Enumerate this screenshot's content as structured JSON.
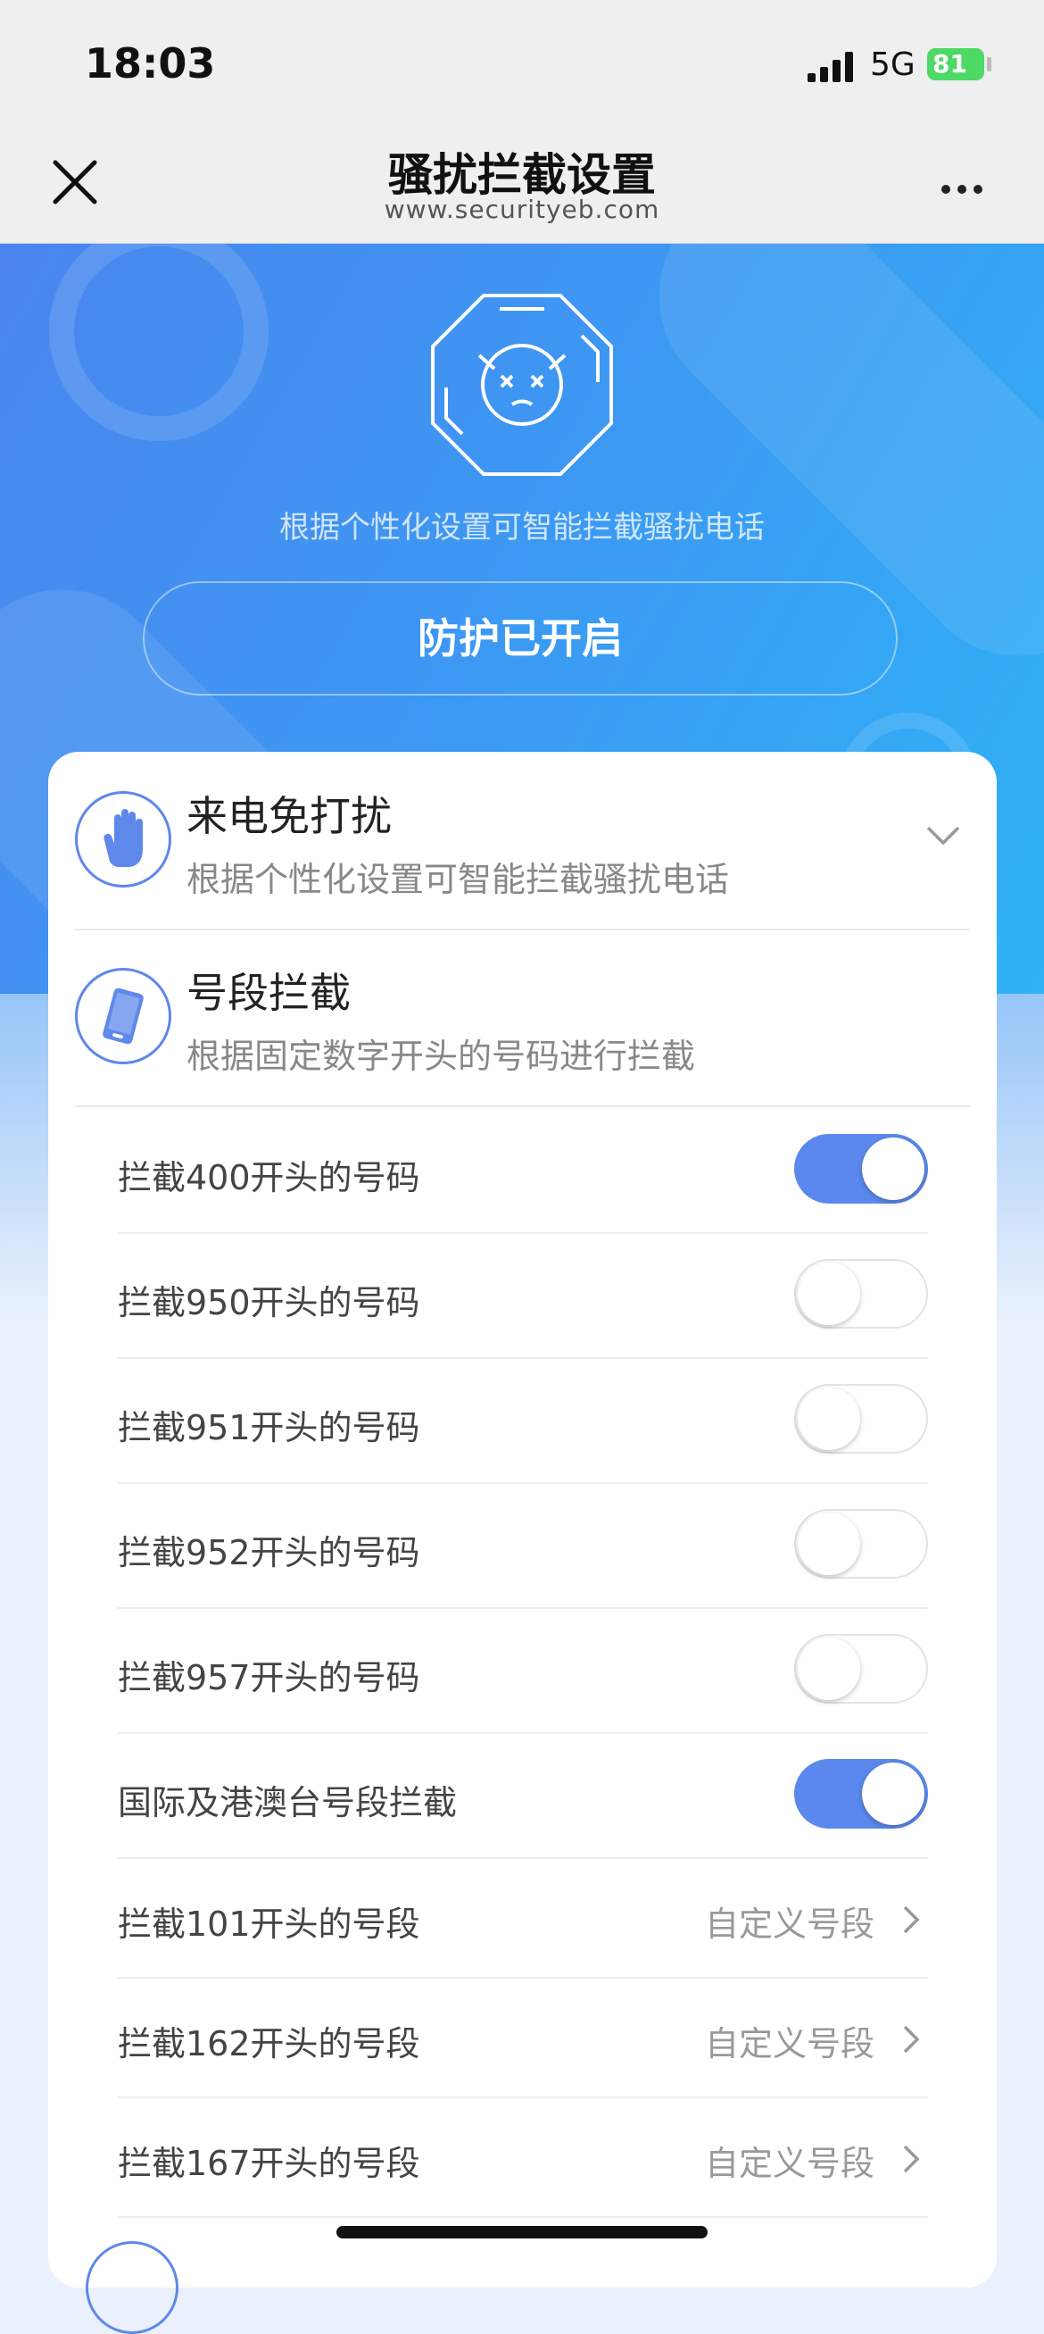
{
  "status_bar": {
    "time": "18:03",
    "network": "5G",
    "battery": "81"
  },
  "nav": {
    "title": "骚扰拦截设置",
    "url": "www.securityeb.com"
  },
  "hero": {
    "description": "根据个性化设置可智能拦截骚扰电话",
    "status_button": "防护已开启"
  },
  "sections": [
    {
      "title": "来电免打扰",
      "description": "根据个性化设置可智能拦截骚扰电话",
      "icon": "hand-stop-icon",
      "expanded": false
    },
    {
      "title": "号段拦截",
      "description": "根据固定数字开头的号码进行拦截",
      "icon": "phone-icon"
    }
  ],
  "toggles": [
    {
      "label": "拦截400开头的号码",
      "on": true
    },
    {
      "label": "拦截950开头的号码",
      "on": false
    },
    {
      "label": "拦截951开头的号码",
      "on": false
    },
    {
      "label": "拦截952开头的号码",
      "on": false
    },
    {
      "label": "拦截957开头的号码",
      "on": false
    },
    {
      "label": "国际及港澳台号段拦截",
      "on": true
    }
  ],
  "links": [
    {
      "label": "拦截101开头的号段",
      "value": "自定义号段"
    },
    {
      "label": "拦截162开头的号段",
      "value": "自定义号段"
    },
    {
      "label": "拦截167开头的号段",
      "value": "自定义号段"
    }
  ],
  "colors": {
    "accent": "#5b88ec",
    "hero_start": "#4a86ee",
    "hero_end": "#2fb2f6"
  }
}
